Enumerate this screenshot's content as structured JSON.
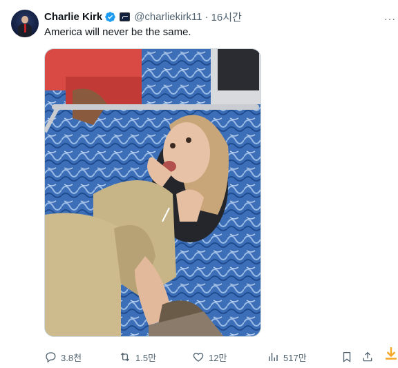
{
  "tweet": {
    "author": {
      "name": "Charlie Kirk",
      "handle": "@charliekirk11",
      "verified_icon": "verified-badge-icon",
      "affiliation_icon": "affiliation-badge-icon"
    },
    "separator": "·",
    "time": "16시간",
    "more": "···",
    "text": "America will never be the same.",
    "media": {
      "description_icon": "photo-media"
    }
  },
  "actions": {
    "reply": {
      "icon": "reply-icon",
      "count": "3.8천"
    },
    "retweet": {
      "icon": "retweet-icon",
      "count": "1.5만"
    },
    "like": {
      "icon": "like-icon",
      "count": "12만"
    },
    "views": {
      "icon": "views-icon",
      "count": "517만"
    },
    "bookmark": {
      "icon": "bookmark-icon"
    },
    "share": {
      "icon": "share-icon"
    },
    "download": {
      "icon": "download-icon"
    }
  },
  "colors": {
    "text_primary": "#0f1419",
    "text_secondary": "#536471",
    "verified_blue": "#1d9bf0",
    "download_orange": "#f5a623"
  }
}
